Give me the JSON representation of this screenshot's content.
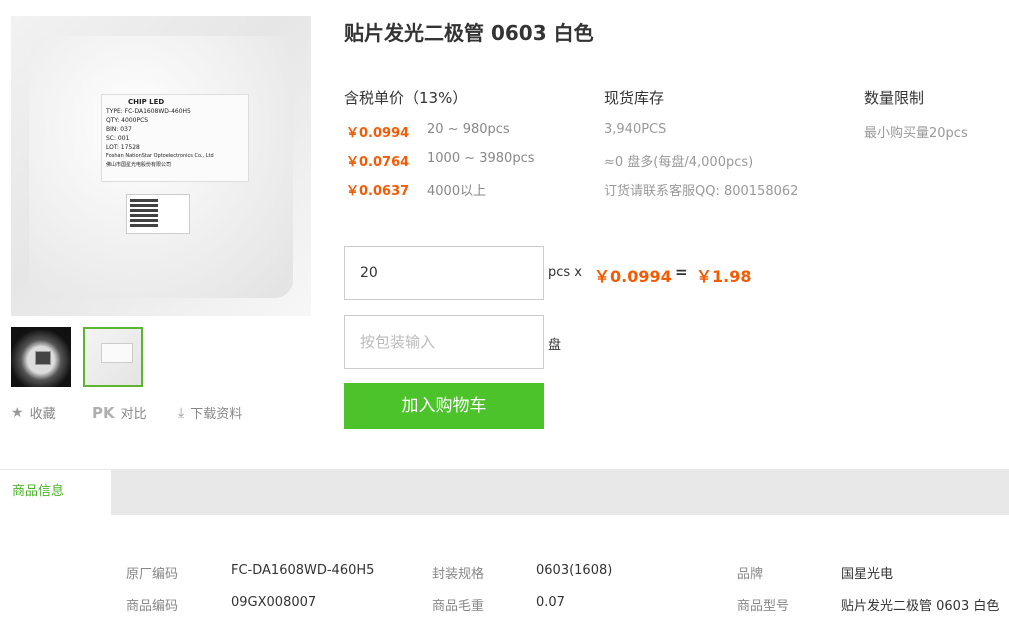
{
  "product": {
    "title": "贴片发光二极管 0603 白色",
    "image_label": {
      "line1": "CHIP  LED",
      "line2": "TYPE:  FC-DA1608WD-460H5",
      "line3": "QTY:   4000PCS",
      "line4": "BIN: 037",
      "line5": "SC: 001",
      "line6": "LOT: 17528",
      "line7": "Foshan NationStar Optoelectronics Co., Ltd",
      "line8": "佛山市国星光电股份有限公司"
    }
  },
  "actions": {
    "favorite": "收藏",
    "compare_icon": "PK",
    "compare": "对比",
    "download": "下载资料"
  },
  "pricing": {
    "header": "含税单价（13%）",
    "tiers": [
      {
        "price": "￥0.0994",
        "range": "20 ~ 980pcs"
      },
      {
        "price": "￥0.0764",
        "range": "1000 ~ 3980pcs"
      },
      {
        "price": "￥0.0637",
        "range": "4000以上"
      }
    ]
  },
  "stock": {
    "header": "现货库存",
    "lines": [
      "3,940PCS",
      "≈0 盘多(每盘/4,000pcs)",
      "订货请联系客服QQ: 800158062"
    ]
  },
  "limit": {
    "header": "数量限制",
    "text": "最小购买量20pcs"
  },
  "order": {
    "quantity": "20",
    "unit": "pcs x",
    "unit_price": "￥0.0994",
    "equals": "=",
    "total": "￥1.98",
    "reel_placeholder": "按包装输入",
    "reel_unit": "盘",
    "add_to_cart": "加入购物车"
  },
  "tabs": {
    "active": "商品信息"
  },
  "specs": [
    [
      {
        "k": "原厂编码",
        "v": "FC-DA1608WD-460H5"
      },
      {
        "k": "封装规格",
        "v": "0603(1608)"
      },
      {
        "k": "品牌",
        "v": "国星光电"
      }
    ],
    [
      {
        "k": "商品编码",
        "v": "09GX008007"
      },
      {
        "k": "商品毛重",
        "v": "0.07"
      },
      {
        "k": "商品型号",
        "v": "贴片发光二极管 0603 白色"
      }
    ]
  ],
  "colors": {
    "price": "#f35b04",
    "accent_green": "#4cc22b",
    "tab_green": "#4cb12c"
  }
}
